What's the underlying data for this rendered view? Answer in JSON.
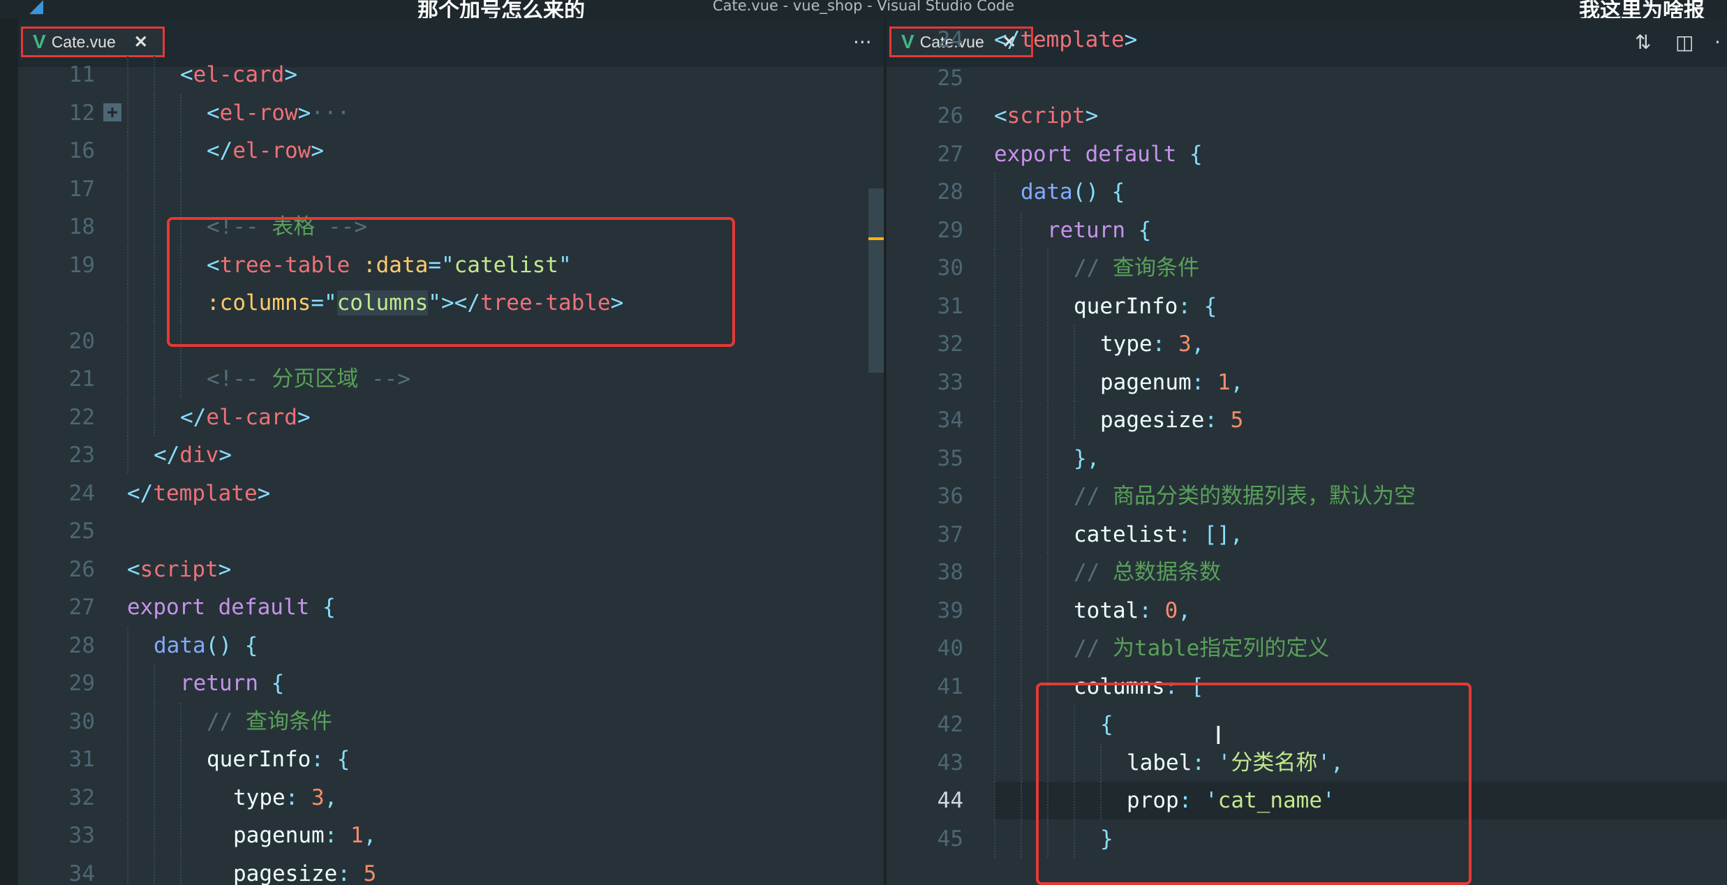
{
  "window": {
    "title": "Cate.vue - vue_shop - Visual Studio Code",
    "subtitle_left": "那个加号怎么来的",
    "subtitle_right": "我这里为啥报"
  },
  "left_pane": {
    "tab_label": "Cate.vue",
    "lines": [
      {
        "n": "11",
        "html": "<span class=\"p\">&lt;</span><span class=\"t\">el-card</span><span class=\"p\">&gt;</span>"
      },
      {
        "n": "12",
        "html": "<span class=\"p\">&lt;</span><span class=\"t\">el-row</span><span class=\"p\">&gt;</span><span class=\"c\">···</span>"
      },
      {
        "n": "16",
        "html": "<span class=\"p\">&lt;/</span><span class=\"t\">el-row</span><span class=\"p\">&gt;</span>"
      },
      {
        "n": "17",
        "html": ""
      },
      {
        "n": "18",
        "html": "<span class=\"c\">&lt;!-- </span><span class=\"c cn\">表格</span><span class=\"c\"> --&gt;</span>"
      },
      {
        "n": "19",
        "html": "<span class=\"p\">&lt;</span><span class=\"t\">tree-table</span> <span class=\"a\">:data</span><span class=\"p\">=\"</span><span class=\"s\">catelist</span><span class=\"p\">\"</span>"
      },
      {
        "n": "",
        "html": "<span class=\"a\">:columns</span><span class=\"p\">=\"</span><span class=\"s hl-col\">columns</span><span class=\"p\">\"&gt;&lt;/</span><span class=\"t\">tree-table</span><span class=\"p\">&gt;</span>"
      },
      {
        "n": "20",
        "html": ""
      },
      {
        "n": "21",
        "html": "<span class=\"c\">&lt;!-- </span><span class=\"c cn\">分页区域</span><span class=\"c\"> --&gt;</span>"
      },
      {
        "n": "22",
        "html": "<span class=\"p\">&lt;/</span><span class=\"t\">el-card</span><span class=\"p\">&gt;</span>"
      },
      {
        "n": "23",
        "html": "<span class=\"p\">&lt;/</span><span class=\"t\">div</span><span class=\"p\">&gt;</span>"
      },
      {
        "n": "24",
        "html": "<span class=\"p\">&lt;/</span><span class=\"t\">template</span><span class=\"p\">&gt;</span>"
      },
      {
        "n": "25",
        "html": ""
      },
      {
        "n": "26",
        "html": "<span class=\"p\">&lt;</span><span class=\"t\">script</span><span class=\"p\">&gt;</span>"
      },
      {
        "n": "27",
        "html": "<span class=\"k\">export default</span> <span class=\"p\">{</span>"
      },
      {
        "n": "28",
        "html": "<span class=\"f\">data</span><span class=\"p\">()</span> <span class=\"p\">{</span>"
      },
      {
        "n": "29",
        "html": "<span class=\"k\">return</span> <span class=\"p\">{</span>"
      },
      {
        "n": "30",
        "html": "<span class=\"c\">// </span><span class=\"c cn\">查询条件</span>"
      },
      {
        "n": "31",
        "html": "<span class=\"prop\">querInfo</span><span class=\"p\">:</span> <span class=\"p\">{</span>"
      },
      {
        "n": "32",
        "html": "<span class=\"prop\">type</span><span class=\"p\">:</span> <span class=\"n\">3</span><span class=\"p\">,</span>"
      },
      {
        "n": "33",
        "html": "<span class=\"prop\">pagenum</span><span class=\"p\">:</span> <span class=\"n\">1</span><span class=\"p\">,</span>"
      },
      {
        "n": "34",
        "html": "<span class=\"prop\">pagesize</span><span class=\"p\">:</span> <span class=\"n\">5</span>"
      }
    ]
  },
  "right_pane": {
    "tab_label": "Cate.vue",
    "lines": [
      {
        "n": "24",
        "html": "<span class=\"p\">&lt;/</span><span class=\"t\">template</span><span class=\"p\">&gt;</span>"
      },
      {
        "n": "25",
        "html": ""
      },
      {
        "n": "26",
        "html": "<span class=\"p\">&lt;</span><span class=\"t\">script</span><span class=\"p\">&gt;</span>"
      },
      {
        "n": "27",
        "html": "<span class=\"k\">export default</span> <span class=\"p\">{</span>"
      },
      {
        "n": "28",
        "html": "<span class=\"f\">data</span><span class=\"p\">()</span> <span class=\"p\">{</span>"
      },
      {
        "n": "29",
        "html": "<span class=\"k\">return</span> <span class=\"p\">{</span>"
      },
      {
        "n": "30",
        "html": "<span class=\"c\">// </span><span class=\"c cn\">查询条件</span>"
      },
      {
        "n": "31",
        "html": "<span class=\"prop\">querInfo</span><span class=\"p\">:</span> <span class=\"p\">{</span>"
      },
      {
        "n": "32",
        "html": "<span class=\"prop\">type</span><span class=\"p\">:</span> <span class=\"n\">3</span><span class=\"p\">,</span>"
      },
      {
        "n": "33",
        "html": "<span class=\"prop\">pagenum</span><span class=\"p\">:</span> <span class=\"n\">1</span><span class=\"p\">,</span>"
      },
      {
        "n": "34",
        "html": "<span class=\"prop\">pagesize</span><span class=\"p\">:</span> <span class=\"n\">5</span>"
      },
      {
        "n": "35",
        "html": "<span class=\"p\">},</span>"
      },
      {
        "n": "36",
        "html": "<span class=\"c\">// </span><span class=\"c cn\">商品分类的数据列表，默认为空</span>"
      },
      {
        "n": "37",
        "html": "<span class=\"prop\">catelist</span><span class=\"p\">:</span> <span class=\"p\">[],</span>"
      },
      {
        "n": "38",
        "html": "<span class=\"c\">// </span><span class=\"c cn\">总数据条数</span>"
      },
      {
        "n": "39",
        "html": "<span class=\"prop\">total</span><span class=\"p\">:</span> <span class=\"n\">0</span><span class=\"p\">,</span>"
      },
      {
        "n": "40",
        "html": "<span class=\"c\">// </span><span class=\"c cn\">为table指定列的定义</span>"
      },
      {
        "n": "41",
        "html": "<span class=\"prop\">columns</span><span class=\"p\">:</span> <span class=\"p\">[</span>"
      },
      {
        "n": "42",
        "html": "<span class=\"p\">{</span>"
      },
      {
        "n": "43",
        "html": "<span class=\"prop\">label</span><span class=\"p\">:</span> <span class=\"p\">'</span><span class=\"s\">分类名称</span><span class=\"p\">',</span>"
      },
      {
        "n": "44",
        "html": "<span class=\"prop\">prop</span><span class=\"p\">:</span> <span class=\"p\">'</span><span class=\"s\">cat_name</span><span class=\"p\">'</span>"
      },
      {
        "n": "45",
        "html": "<span class=\"p\">}</span>"
      }
    ]
  }
}
